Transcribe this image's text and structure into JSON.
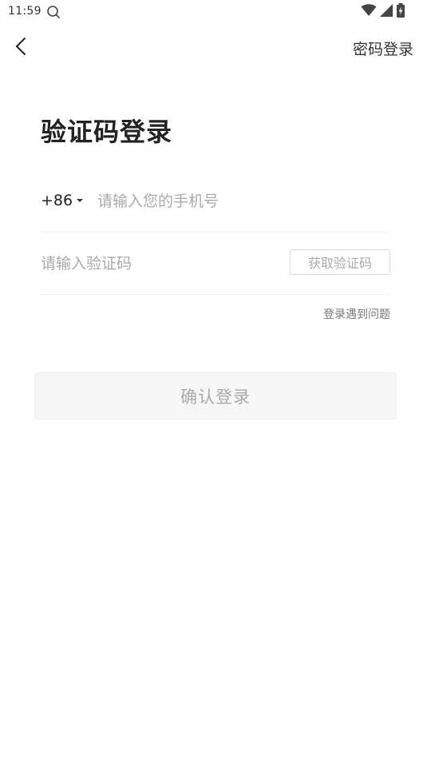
{
  "status_bar": {
    "time": "11:59"
  },
  "header": {
    "password_login_label": "密码登录"
  },
  "page": {
    "title": "验证码登录"
  },
  "phone": {
    "country_code": "+86",
    "placeholder": "请输入您的手机号",
    "value": ""
  },
  "code": {
    "placeholder": "请输入验证码",
    "value": "",
    "get_code_label": "获取验证码"
  },
  "links": {
    "login_problem": "登录遇到问题"
  },
  "actions": {
    "confirm_label": "确认登录"
  },
  "icons": {
    "search": "search-icon",
    "wifi": "wifi-icon",
    "signal": "signal-icon",
    "battery": "battery-charging-icon",
    "back": "back-arrow-icon"
  },
  "colors": {
    "placeholder": "#aaaaaa",
    "button_bg": "#f6f6f6",
    "divider": "#f0f0f0"
  }
}
